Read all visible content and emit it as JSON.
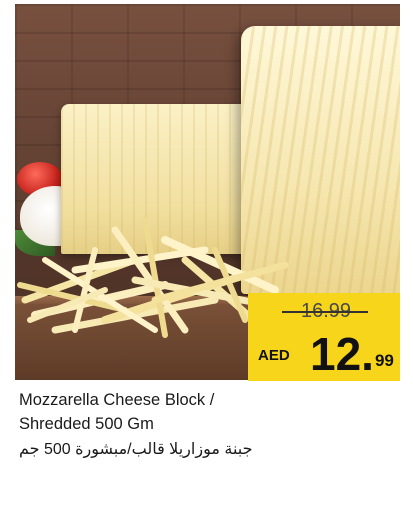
{
  "product": {
    "name_en_line1": "Mozzarella Cheese Block /",
    "name_en_line2": "Shredded 500 Gm",
    "name_ar": "جبنة موزاريلا قالب/مبشورة 500 جم"
  },
  "price": {
    "old": "16.99",
    "currency": "AED",
    "new_integer": "12.",
    "new_decimal": "99"
  },
  "colors": {
    "price_tag": "#f7d51a",
    "text": "#1a1a1a"
  }
}
